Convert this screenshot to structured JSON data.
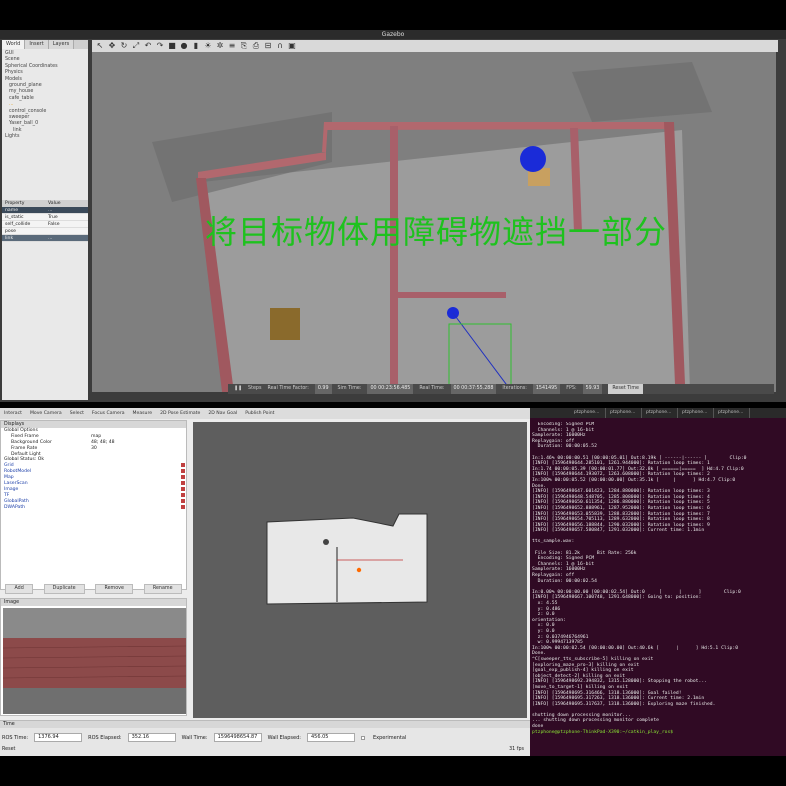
{
  "gazebo": {
    "title": "Gazebo",
    "tabs": [
      "World",
      "Insert",
      "Layers"
    ],
    "tree": [
      {
        "label": "GUI",
        "depth": 0
      },
      {
        "label": "Scene",
        "depth": 0
      },
      {
        "label": "Spherical Coordinates",
        "depth": 0
      },
      {
        "label": "Physics",
        "depth": 0
      },
      {
        "label": "Models",
        "depth": 0
      },
      {
        "label": "ground_plane",
        "depth": 1
      },
      {
        "label": "my_house",
        "depth": 1
      },
      {
        "label": "cafe_table",
        "depth": 1
      },
      {
        "label": "...",
        "depth": 1
      },
      {
        "label": "control_console",
        "depth": 1
      },
      {
        "label": "sweeper",
        "depth": 1
      },
      {
        "label": "Yaser_ball_0",
        "depth": 1
      },
      {
        "label": "link",
        "depth": 2
      },
      {
        "label": "Lights",
        "depth": 0
      }
    ],
    "props_header": {
      "property": "Property",
      "value": "Value"
    },
    "props": [
      {
        "name": "name",
        "value": "...",
        "style": "blue"
      },
      {
        "name": "is_static",
        "value": "True",
        "style": ""
      },
      {
        "name": "self_collide",
        "value": "False",
        "style": ""
      },
      {
        "name": "pose",
        "value": "",
        "style": ""
      },
      {
        "name": "link",
        "value": "...",
        "style": "strip"
      }
    ],
    "overlay_text": "将目标物体用障碍物遮挡一部分",
    "bottom": {
      "steps_label": "Steps",
      "rtf_label": "Real Time Factor:",
      "rtf_value": "0.99",
      "sim_label": "Sim Time:",
      "sim_value": "00 00:23:56.485",
      "real_label": "Real Time:",
      "real_value": "00 00:37:55.288",
      "iter_label": "Iterations:",
      "iter_value": "1541495",
      "fps_label": "FPS:",
      "fps_value": "59.93",
      "reset_label": "Reset Time"
    }
  },
  "rviz": {
    "toolbar": [
      "Interact",
      "Move Camera",
      "Select",
      "Focus Camera",
      "Measure",
      "2D Pose Estimate",
      "2D Nav Goal",
      "Publish Point"
    ],
    "displays_title": "Displays",
    "displays": [
      {
        "name": "Global Options",
        "value": "",
        "depth": 0,
        "blue": false
      },
      {
        "name": "Fixed Frame",
        "value": "map",
        "depth": 1,
        "blue": false
      },
      {
        "name": "Background Color",
        "value": "48; 48; 48",
        "depth": 1,
        "blue": false
      },
      {
        "name": "Frame Rate",
        "value": "30",
        "depth": 1,
        "blue": false
      },
      {
        "name": "Default Light",
        "value": "",
        "depth": 1,
        "blue": false
      },
      {
        "name": "Global Status: Ok",
        "value": "",
        "depth": 0,
        "blue": false
      },
      {
        "name": "Grid",
        "value": "",
        "depth": 0,
        "blue": true
      },
      {
        "name": "RobotModel",
        "value": "",
        "depth": 0,
        "blue": true
      },
      {
        "name": "Map",
        "value": "",
        "depth": 0,
        "blue": true
      },
      {
        "name": "LaserScan",
        "value": "",
        "depth": 0,
        "blue": true
      },
      {
        "name": "Image",
        "value": "",
        "depth": 0,
        "blue": true
      },
      {
        "name": "TF",
        "value": "",
        "depth": 0,
        "blue": true
      },
      {
        "name": "GlobalPath",
        "value": "",
        "depth": 0,
        "blue": true
      },
      {
        "name": "DWAPath",
        "value": "",
        "depth": 0,
        "blue": true
      }
    ],
    "buttons": [
      "Add",
      "Duplicate",
      "Remove",
      "Rename"
    ],
    "image_title": "Image",
    "time_title": "Time",
    "ros_time_label": "ROS Time:",
    "ros_time_value": "1376.94",
    "ros_elapsed_label": "ROS Elapsed:",
    "ros_elapsed_value": "352.16",
    "wall_time_label": "Wall Time:",
    "wall_time_value": "1596498654.87",
    "wall_elapsed_label": "Wall Elapsed:",
    "wall_elapsed_value": "456.05",
    "experimental_label": "Experimental",
    "reset_label": "Reset",
    "fps": "31 fps"
  },
  "terminal": {
    "tabs": [
      "ptzphone...",
      "ptzphone...",
      "ptzphone...",
      "ptzphone...",
      "ptzphone..."
    ],
    "lines": [
      "  Encoding: Signed PCM",
      "  Channels: 1 @ 16-bit",
      "Samplerate: 16000Hz",
      "Replaygain: off",
      "  Duration: 00:00:05.52",
      "",
      "In:1.46% 00:00:00.51 [00:00:05.01] Out:8.19k [ ------|------ ]        Clip:0",
      "[INFO] [1596498644.285101, 1261.944000]: Rotation loop times: 1",
      "In:1.74 00:00:05.39 [00:00:01.77] Out:32.8k [ ======|=====  ] Hd:4.7 Clip:0",
      "[INFO] [1596498644.193072, 1263.608000]: Rotation loop times: 2",
      "In:100% 00:00:05.52 [00:00:00.00] Out:35.1k [     |      ] Hd:4.7 Clip:0",
      "Done.",
      "[INFO] [1596498647.601423, 1284.880000]: Rotation loop times: 3",
      "[INFO] [1596498648.548705, 1285.808000]: Rotation loop times: 4",
      "[INFO] [1596498650.611354, 1286.880000]: Rotation loop times: 5",
      "[INFO] [1596498652.888961, 1287.952000]: Rotation loop times: 6",
      "[INFO] [1596498653.055839, 1288.832000]: Rotation loop times: 7",
      "[INFO] [1596498654.705113, 1289.632000]: Rotation loop times: 8",
      "[INFO] [1596498656.188844, 1290.032000]: Rotation loop times: 9",
      "[INFO] [1596498657.580847, 1291.032000]: Current time: 1.1min",
      "",
      "tts_sample.wav:",
      "",
      " File Size: 81.2k      Bit Rate: 256k",
      "  Encoding: Signed PCM",
      "  Channels: 1 @ 16-bit",
      "Samplerate: 16000Hz",
      "Replaygain: off",
      "  Duration: 00:00:02.54",
      "",
      "In:0.00% 00:00:00.00 [00:00:02.54] Out:0     [      |      ]        Clip:0",
      "[INFO] [1596498667.100748, 1291.648000]: Going to: position:",
      "  x: 4.55",
      "  y: 0.486",
      "  z: 0.0",
      "orientation:",
      "  x: 0.0",
      "  y: 0.0",
      "  z: 0.0374946764961",
      "  w: 0.99947139785",
      "In:100% 00:00:02.54 [00:00:00.00] Out:40.6k [      |      ] Hd:5.1 Clip:0",
      "Done.",
      "^C[sweeper_tts_subscribe-5] killing on exit",
      "[exploring_maze_pro-3] killing on exit",
      "[goal_exp_publish-4] killing on exit",
      "[object_detect-2] killing on exit",
      "[INFO] [1596498692.394832, 1315.128000]: Stopping the robot...",
      "[move_to_target-1] killing on exit",
      "[INFO] [1596498695.316466, 1318.136000]: Goal failed!",
      "[INFO] [1596498695.317263, 1318.136000]: Current time: 2.1min",
      "[INFO] [1596498695.317637, 1318.136000]: Exploring maze finished.",
      "",
      "shutting down processing monitor...",
      "... shutting down processing monitor complete",
      "done"
    ],
    "prompt": "ptzphone@ptzphone-ThinkPad-X390:~/catkin_play_ros$"
  },
  "colors": {
    "terminal_bg": "#300a24",
    "overlay_green": "#1ec21e",
    "wall_brick": "#a0585f",
    "rviz_bg": "#303030"
  }
}
